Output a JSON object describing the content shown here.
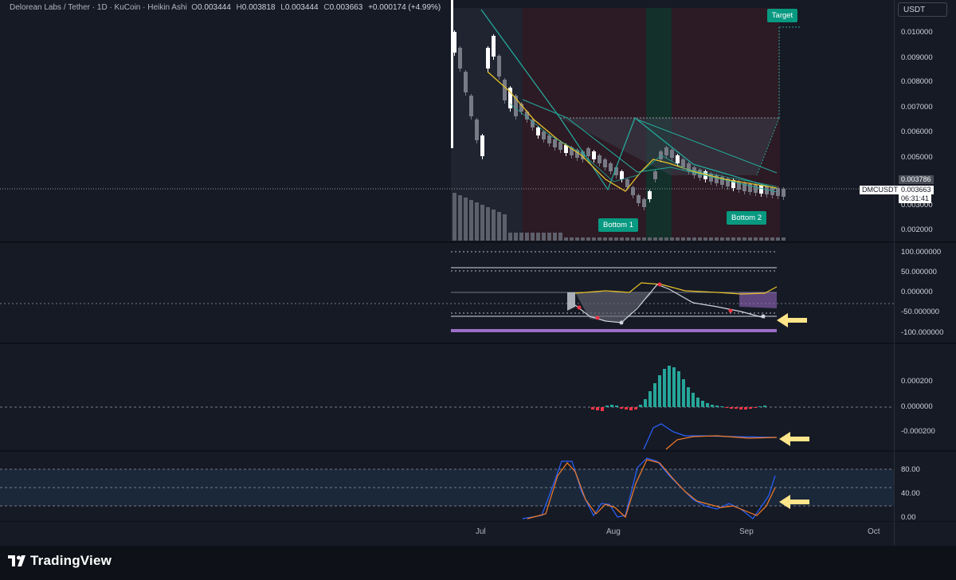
{
  "header": {
    "symbol": "Delorean Labs / Tether · 1D · KuCoin · Heikin Ashi",
    "o_label": "O",
    "o_value": "0.003444",
    "h_label": "H",
    "h_value": "0.003818",
    "l_label": "L",
    "l_value": "0.003444",
    "c_label": "C",
    "c_value": "0.003663",
    "change": "+0.000174 (+4.99%)"
  },
  "price_scale": {
    "currency": "USDT",
    "ticks": [
      "0.010000",
      "0.009000",
      "0.008000",
      "0.007000",
      "0.006000",
      "0.005000",
      "0.004000",
      "0.003000",
      "0.002000"
    ],
    "ticker_label": "DMCUSDT",
    "high_label": "0.003786",
    "last_price": "0.003663",
    "countdown": "06:31:41"
  },
  "rsi_scale": {
    "ticks": [
      "100.000000",
      "50.000000",
      "0.000000",
      "-50.000000",
      "-100.000000"
    ]
  },
  "macd_scale": {
    "ticks": [
      "0.000200",
      "0.000000",
      "-0.000200"
    ]
  },
  "stoch_scale": {
    "ticks": [
      "80.00",
      "40.00",
      "0.00"
    ]
  },
  "time_axis": {
    "ticks": [
      "Jul",
      "Aug",
      "Sep",
      "Oct"
    ]
  },
  "annotations": {
    "target": "Target",
    "bottom1": "Bottom 1",
    "bottom2": "Bottom 2"
  },
  "branding": {
    "name": "TradingView"
  },
  "colors": {
    "up": "#ffffff",
    "down": "#787b86",
    "teal": "#26a69a",
    "accent_green": "#089981",
    "ma_yellow": "#e6c229",
    "red_zone": "#3a1c27",
    "green_zone": "#12302a",
    "macd_up": "#26a69a",
    "macd_down": "#f23645",
    "stoch_k": "#2962ff",
    "stoch_d": "#f57c28",
    "arrow": "#ffe58a"
  }
}
